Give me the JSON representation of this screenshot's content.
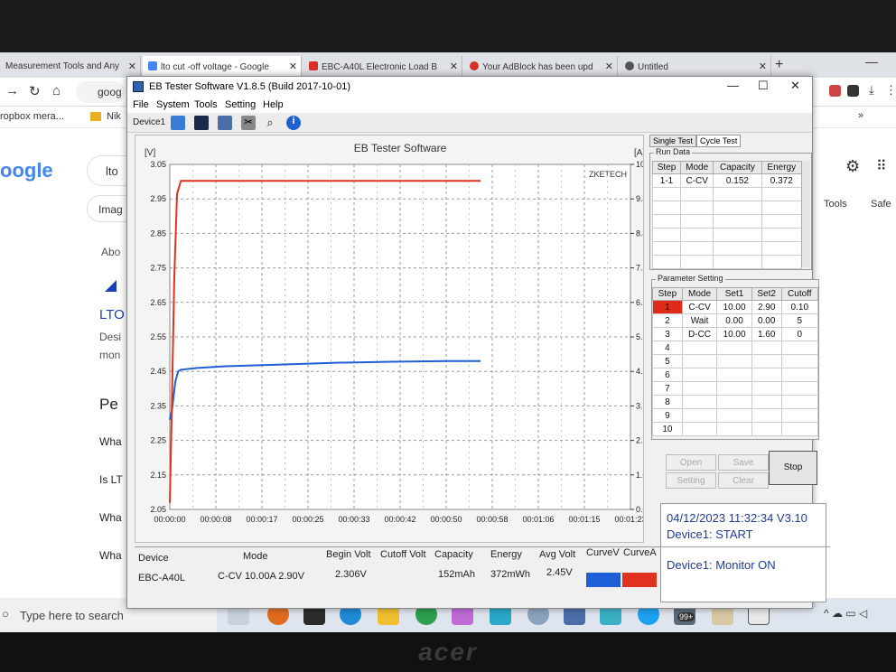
{
  "browser": {
    "tabs": [
      {
        "label": "Measurement Tools and Any",
        "color": "#3a6ee0"
      },
      {
        "label": "lto cut -off voltage - Google",
        "color": "#4285f4"
      },
      {
        "label": "EBC-A40L Electronic Load B",
        "color": "#d93025"
      },
      {
        "label": "Your AdBlock has been upd",
        "color": "#d93025"
      },
      {
        "label": "Untitled",
        "color": "#555555"
      }
    ],
    "new_tab": "+",
    "url_text": "goog",
    "bookmarks": [
      {
        "label": "ropbox ",
        "suffix": "mera..."
      },
      {
        "label": "Nik"
      }
    ],
    "bookmarks_more": "»"
  },
  "google": {
    "logo": "oogle",
    "search_text": "lto",
    "chip": "Imag",
    "about": "Abo",
    "result_title": "LTO",
    "snippet1": "Desi",
    "snippet2": "mon",
    "heading": "Pe",
    "q1": "Wha",
    "q2": "Is LT",
    "q3": "Wha",
    "q4": "Wha",
    "tools": "Tools",
    "safe": "Safe"
  },
  "taskbar": {
    "search_placeholder": "Type here to search",
    "badge": "99+"
  },
  "app": {
    "title": "EB Tester Software V1.8.5 (Build 2017-10-01)",
    "win_min": "—",
    "win_max": "☐",
    "win_close": "✕",
    "menu": [
      "File",
      "System",
      "Tools",
      "Setting",
      "Help"
    ],
    "device_tab": "Device1",
    "tabs": [
      "Single Test",
      "Cycle Test"
    ],
    "run_data": {
      "label": "Run Data",
      "headers": [
        "Step",
        "Mode",
        "Capacity",
        "Energy"
      ],
      "rows": [
        [
          "1-1",
          "C-CV",
          "0.152",
          "0.372"
        ]
      ]
    },
    "params": {
      "label": "Parameter Setting",
      "headers": [
        "Step",
        "Mode",
        "Set1",
        "Set2",
        "Cutoff"
      ],
      "rows": [
        [
          "1",
          "C-CV",
          "10.00",
          "2.90",
          "0.10"
        ],
        [
          "2",
          "Wait",
          "0.00",
          "0.00",
          "5"
        ],
        [
          "3",
          "D-CC",
          "10.00",
          "1.60",
          "0"
        ],
        [
          "4",
          "",
          "",
          "",
          ""
        ],
        [
          "5",
          "",
          "",
          "",
          ""
        ],
        [
          "6",
          "",
          "",
          "",
          ""
        ],
        [
          "7",
          "",
          "",
          "",
          ""
        ],
        [
          "8",
          "",
          "",
          "",
          ""
        ],
        [
          "9",
          "",
          "",
          "",
          ""
        ],
        [
          "10",
          "",
          "",
          "",
          ""
        ]
      ]
    },
    "buttons": {
      "open": "Open",
      "save": "Save",
      "setting": "Setting",
      "clear": "Clear",
      "stop": "Stop"
    },
    "log": {
      "line1": "04/12/2023 11:32:34  V3.10",
      "line2": "Device1: START",
      "line3": "Device1: Monitor ON"
    },
    "summary": {
      "headers": [
        "Device",
        "Mode",
        "Begin Volt",
        "Cutoff Volt",
        "Capacity",
        "Energy",
        "Avg Volt",
        "CurveV",
        "CurveA"
      ],
      "values": [
        "EBC-A40L",
        "C-CV  10.00A  2.90V",
        "2.306V",
        "",
        "152mAh",
        "372mWh",
        "2.45V"
      ],
      "curveV_color": "#1e5fd8",
      "curveA_color": "#e0321f"
    }
  },
  "chart_data": {
    "type": "line",
    "title": "EB Tester Software",
    "watermark": "ZKETECH",
    "ylabel_left": "[V]",
    "ylabel_right": "[A]",
    "ylim": [
      2.05,
      3.05
    ],
    "y2lim": [
      0.0,
      10.5
    ],
    "xlim_seconds": [
      0,
      83
    ],
    "yticks": [
      "3.05",
      "2.95",
      "2.85",
      "2.75",
      "2.65",
      "2.55",
      "2.45",
      "2.35",
      "2.25",
      "2.15",
      "2.05"
    ],
    "y2ticks": [
      "10.50",
      "9.45",
      "8.40",
      "7.35",
      "6.30",
      "5.25",
      "4.20",
      "3.15",
      "2.10",
      "1.05",
      "0.00"
    ],
    "xticks": [
      "00:00:00",
      "00:00:08",
      "00:00:17",
      "00:00:25",
      "00:00:33",
      "00:00:42",
      "00:00:50",
      "00:00:58",
      "00:01:06",
      "00:01:15",
      "00:01:23"
    ],
    "grid": true,
    "series": [
      {
        "name": "CurveV",
        "color": "#1e5fd8",
        "x": [
          0,
          0.4,
          1,
          1.5,
          2,
          5,
          10,
          20,
          30,
          40,
          50,
          56
        ],
        "y": [
          2.31,
          2.34,
          2.42,
          2.45,
          2.455,
          2.46,
          2.465,
          2.47,
          2.475,
          2.478,
          2.48,
          2.48
        ]
      },
      {
        "name": "CurveA",
        "color": "#e0321f",
        "x": [
          0,
          0.3,
          0.8,
          1.3,
          2,
          10,
          30,
          56
        ],
        "y": [
          0.2,
          2.5,
          7.0,
          9.6,
          10.0,
          10.0,
          10.0,
          10.0
        ]
      }
    ]
  }
}
